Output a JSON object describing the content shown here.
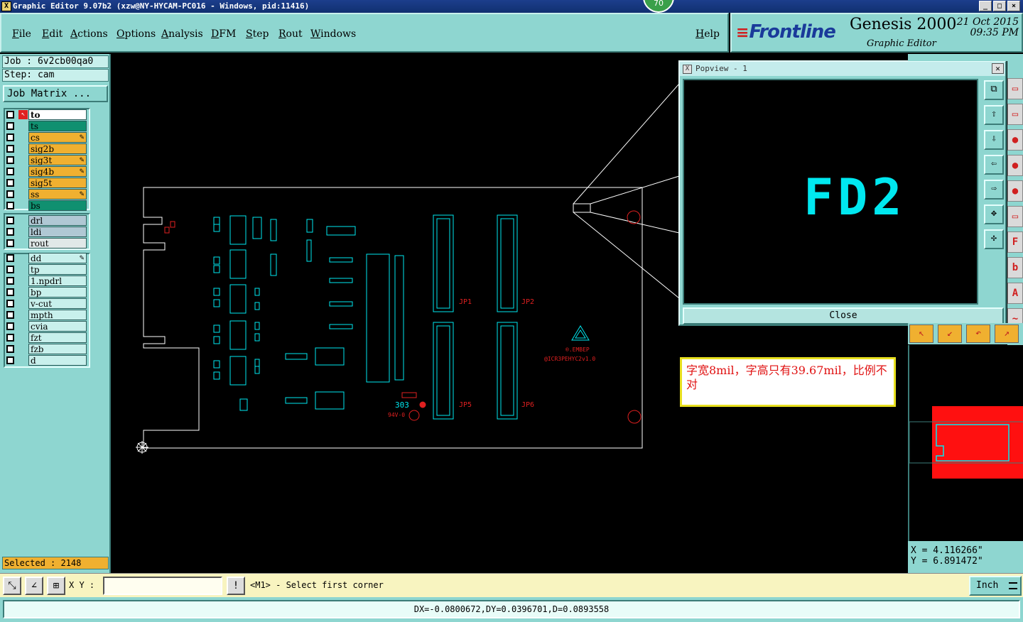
{
  "window": {
    "title": "Graphic Editor 9.07b2 (xzw@NY-HYCAM-PC016 - Windows, pid:11416)",
    "badge": "70",
    "controls": [
      "_",
      "□",
      "×"
    ]
  },
  "menu": [
    "File",
    "Edit",
    "Actions",
    "Options",
    "Analysis",
    "DFM",
    "Step",
    "Rout",
    "Windows"
  ],
  "help": "Help",
  "brand": {
    "logo": "Frontline",
    "product": "Genesis 2000",
    "subtitle": "Graphic Editor",
    "date": "21 Oct 2015",
    "time": "09:35 PM"
  },
  "job": {
    "job_label": "Job : 6v2cb00qa0",
    "step_label": "Step: cam",
    "matrix_button": "Job Matrix ..."
  },
  "layers": [
    {
      "name": "to",
      "style": "active"
    },
    {
      "name": "ts",
      "style": "green"
    },
    {
      "name": "cs",
      "style": "orange",
      "mark": true
    },
    {
      "name": "sig2b",
      "style": "orange"
    },
    {
      "name": "sig3t",
      "style": "orange",
      "mark": true
    },
    {
      "name": "sig4b",
      "style": "orange",
      "mark": true
    },
    {
      "name": "sig5t",
      "style": "orange"
    },
    {
      "name": "ss",
      "style": "orange",
      "mark": true
    },
    {
      "name": "bs",
      "style": "green"
    },
    {
      "name": "drl",
      "style": "grayblue"
    },
    {
      "name": "ldi",
      "style": "grayblue"
    },
    {
      "name": "rout",
      "style": "white"
    },
    {
      "name": "dd",
      "style": "lightcyan",
      "mark": true
    },
    {
      "name": "tp",
      "style": "lightcyan"
    },
    {
      "name": "1.npdrl",
      "style": "lightcyan"
    },
    {
      "name": "bp",
      "style": "lightcyan"
    },
    {
      "name": "v-cut",
      "style": "lightcyan"
    },
    {
      "name": "mpth",
      "style": "lightcyan"
    },
    {
      "name": "cvia",
      "style": "lightcyan"
    },
    {
      "name": "fzt",
      "style": "lightcyan"
    },
    {
      "name": "fzb",
      "style": "lightcyan"
    },
    {
      "name": "d",
      "style": "lightcyan"
    }
  ],
  "selected": "Selected : 2148",
  "board": {
    "connectors": [
      "JP1",
      "JP2",
      "JP5",
      "JP6"
    ],
    "silk_text": [
      "@ICR3PEHYC2v1.0",
      "®.EMBEP",
      "303",
      "94V-0"
    ]
  },
  "popview": {
    "title": "Popview - 1",
    "zoom_text": "FD2",
    "close_label": "Close"
  },
  "note": "字宽8mil，字高只有39.67mil，比例不对",
  "coords": {
    "x": "X = 4.116266\"",
    "y": "Y = 6.891472\""
  },
  "command": {
    "xy_label": "X Y :",
    "xy_value": "",
    "prompt": "<M1> - Select first corner",
    "units": "Inch"
  },
  "status": "DX=-0.0800672,DY=0.0396701,D=0.0893558",
  "colors": {
    "panel": "#8ed6d0",
    "board_outline": "#ffffff",
    "component": "#00e8f0",
    "silk_red": "#e02020",
    "note_text": "#e01010"
  }
}
